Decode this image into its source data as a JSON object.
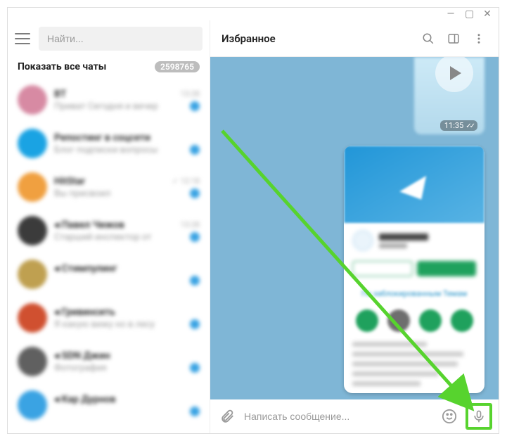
{
  "window": {
    "minimize": "—",
    "maximize": "▢",
    "close": "✕"
  },
  "sidebar": {
    "search_placeholder": "Найти...",
    "filter_label": "Показать все чаты",
    "filter_badge": "2598765",
    "chats": [
      {
        "name": "ВТ",
        "preview": "Приват Сегодня и вечер",
        "time": "13:28",
        "color": "#d78aa3"
      },
      {
        "name": "Репостинг в соцсети",
        "preview": "Блог подписки вопросы",
        "time": "",
        "color": "#1aa3e3"
      },
      {
        "name": "HitStar",
        "preview": "Вы присвоил",
        "time": "✓ 12:18",
        "color": "#f0a040"
      },
      {
        "name": "◂ Павел Чижов",
        "preview": "Старший инспектор от",
        "time": "13:28",
        "color": "#3b3b3b"
      },
      {
        "name": "◂ Стимпулинг",
        "preview": "",
        "time": "",
        "color": "#bfa050"
      },
      {
        "name": "◂ Гривинсить",
        "preview": "Я какую вижу но в лесу",
        "time": "",
        "color": "#d05030"
      },
      {
        "name": "◂ SDN Джин",
        "preview": "Фотография",
        "time": "",
        "color": "#606060"
      },
      {
        "name": "◂ Кар Дурнов",
        "preview": "",
        "time": "",
        "color": "#3aa3e3"
      }
    ]
  },
  "chat": {
    "title": "Избранное",
    "message1_time": "11:35",
    "message2_link": "По заблокированным Темам"
  },
  "compose": {
    "placeholder": "Написать сообщение..."
  }
}
